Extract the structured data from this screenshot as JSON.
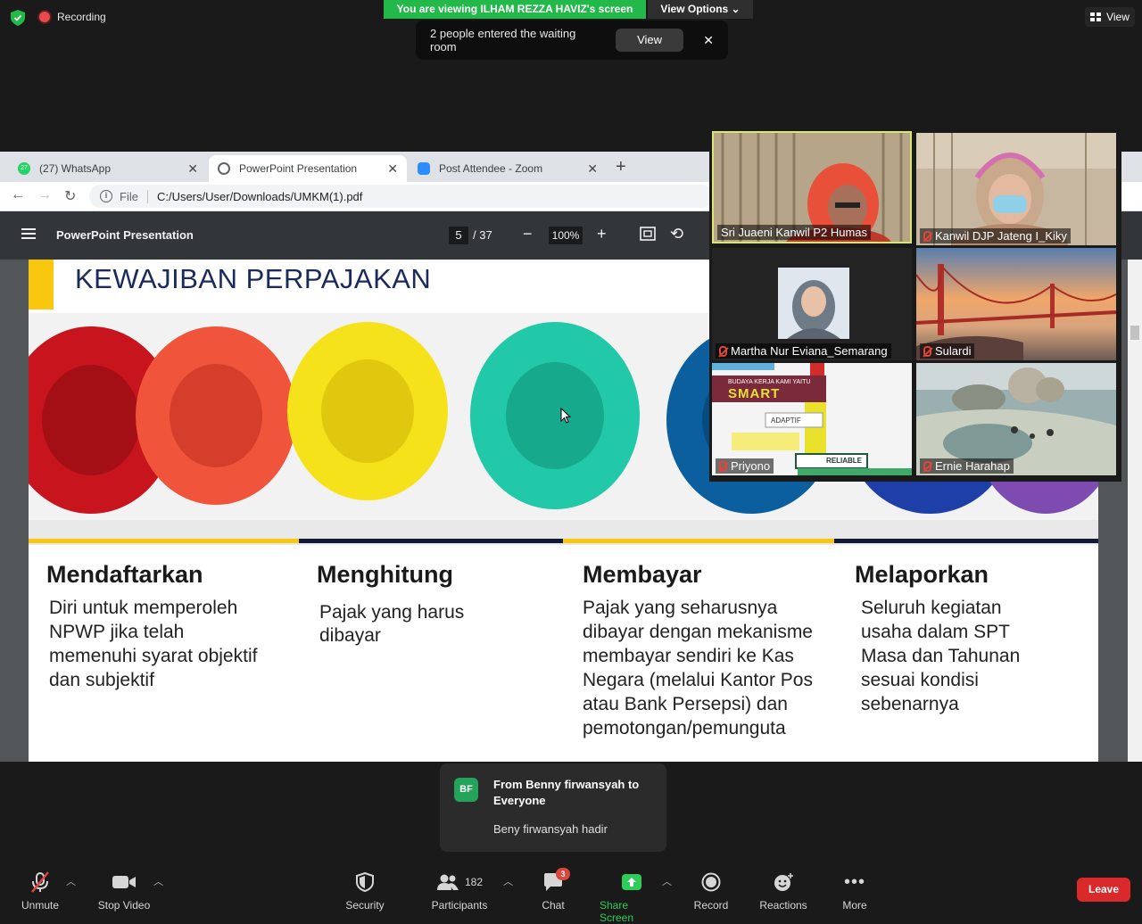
{
  "zoom_top": {
    "recording_label": "Recording",
    "viewing_banner": "You are viewing ILHAM REZZA HAVIZ's screen",
    "view_options": "View Options ⌄",
    "waiting_room_text": "2 people entered the waiting room",
    "waiting_view_button": "View",
    "waiting_close": "✕",
    "view_button": "View"
  },
  "browser": {
    "tabs": [
      {
        "label": "(27) WhatsApp",
        "icon": "whatsapp-icon",
        "badge": "27"
      },
      {
        "label": "PowerPoint Presentation",
        "icon": "globe-icon"
      },
      {
        "label": "Post Attendee - Zoom",
        "icon": "zoom-icon"
      }
    ],
    "new_tab": "+",
    "address_prefix": "File",
    "address": "C:/Users/User/Downloads/UMKM(1).pdf"
  },
  "pdf": {
    "title": "PowerPoint Presentation",
    "page_current": "5",
    "page_total": "/ 37",
    "zoom": "100%"
  },
  "slide": {
    "title": "KEWAJIBAN PERPAJAKAN",
    "columns": [
      {
        "heading": "Mendaftarkan",
        "body": "Diri untuk memperoleh NPWP jika telah memenuhi syarat objektif dan subjektif"
      },
      {
        "heading": "Menghitung",
        "body": "Pajak yang harus dibayar"
      },
      {
        "heading": "Membayar",
        "body": "Pajak yang seharusnya dibayar dengan mekanisme membayar sendiri ke Kas Negara (melalui Kantor Pos atau Bank Persepsi) dan pemotongan/pemunguta"
      },
      {
        "heading": "Melaporkan",
        "body": "Seluruh kegiatan usaha dalam SPT Masa dan Tahunan sesuai kondisi sebenarnya"
      }
    ],
    "stripe_colors": [
      "#f9c80e",
      "#111a3b",
      "#f9c80e",
      "#111a3b"
    ]
  },
  "participants": [
    {
      "name": "Sri Juaeni Kanwil P2 Humas",
      "muted": false,
      "active_speaker": true
    },
    {
      "name": "Kanwil DJP Jateng I_Kiky",
      "muted": true
    },
    {
      "name": "Martha Nur Eviana_Semarang",
      "muted": true
    },
    {
      "name": "Sulardi",
      "muted": true
    },
    {
      "name": "Priyono",
      "muted": true
    },
    {
      "name": "Ernie Harahap",
      "muted": true
    }
  ],
  "priyono_slide": {
    "line1": "BUDAYA KERJA KAMI YAITU",
    "brand": "SMART",
    "adaptif": "ADAPTIF",
    "reliable": "RELIABLE"
  },
  "chat_toast": {
    "avatar": "BF",
    "from": "From Benny firwansyah to Everyone",
    "message": "Beny firwansyah hadir"
  },
  "toolbar": {
    "unmute": "Unmute",
    "stop_video": "Stop Video",
    "security": "Security",
    "participants": "Participants",
    "participants_count": "182",
    "chat": "Chat",
    "chat_badge": "3",
    "share_screen": "Share Screen",
    "record": "Record",
    "reactions": "Reactions",
    "more": "More",
    "leave": "Leave"
  },
  "colors": {
    "green_banner": "#23b84a",
    "share_green": "#2dcd58",
    "leave_red": "#d9292b",
    "slide_title": "#1b2a5c",
    "active_speaker_border": "#d9e86b"
  }
}
